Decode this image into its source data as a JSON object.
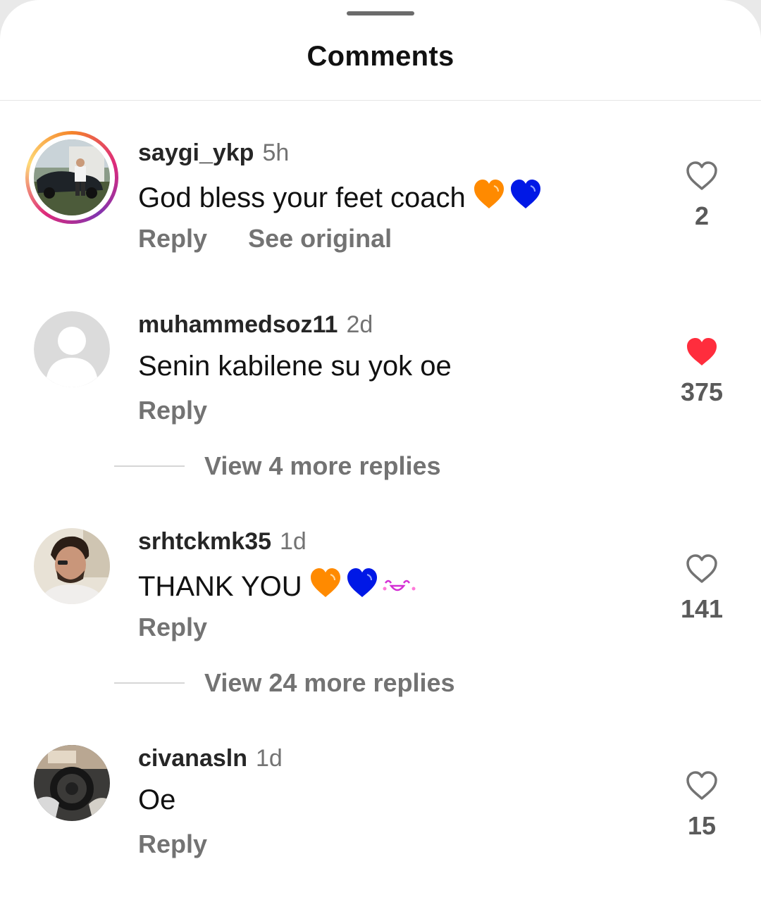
{
  "sheet": {
    "title": "Comments"
  },
  "colors": {
    "liked_heart": "#ff2d3d",
    "orange_heart": "#ff8a00",
    "blue_heart": "#0018e6",
    "muted_text": "#737373"
  },
  "comments": [
    {
      "username": "saygi_ykp",
      "time": "5h",
      "text": "God bless your feet coach",
      "emojis": [
        "orange-heart",
        "blue-heart"
      ],
      "actions": {
        "reply": "Reply",
        "see_original": "See original"
      },
      "liked": false,
      "likes": "2",
      "has_story_ring": true
    },
    {
      "username": "muhammedsoz11",
      "time": "2d",
      "text": "Senin kabilene su yok oe",
      "emojis": [],
      "actions": {
        "reply": "Reply"
      },
      "liked": true,
      "likes": "375",
      "view_replies": "View 4 more replies"
    },
    {
      "username": "srhtckmk35",
      "time": "1d",
      "text": "THANK YOU",
      "emojis": [
        "orange-heart",
        "blue-heart",
        "happy-face"
      ],
      "actions": {
        "reply": "Reply"
      },
      "liked": false,
      "likes": "141",
      "view_replies": "View 24 more replies"
    },
    {
      "username": "civanasln",
      "time": "1d",
      "text": "Oe",
      "emojis": [],
      "actions": {
        "reply": "Reply"
      },
      "liked": false,
      "likes": "15"
    }
  ]
}
